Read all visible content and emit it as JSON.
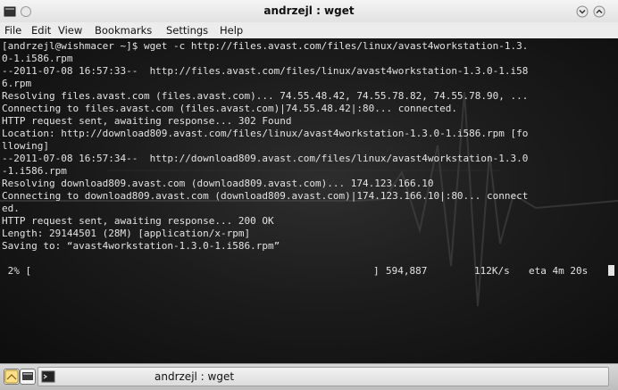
{
  "window": {
    "title": "andrzejl : wget"
  },
  "menubar": {
    "items": [
      "File",
      "Edit",
      "View",
      "Bookmarks",
      "Settings",
      "Help"
    ]
  },
  "terminal": {
    "lines": [
      "[andrzejl@wishmacer ~]$ wget -c http://files.avast.com/files/linux/avast4workstation-1.3.",
      "0-1.i586.rpm",
      "--2011-07-08 16:57:33--  http://files.avast.com/files/linux/avast4workstation-1.3.0-1.i58",
      "6.rpm",
      "Resolving files.avast.com (files.avast.com)... 74.55.48.42, 74.55.78.82, 74.55.78.90, ...",
      "Connecting to files.avast.com (files.avast.com)|74.55.48.42|:80... connected.",
      "HTTP request sent, awaiting response... 302 Found",
      "Location: http://download809.avast.com/files/linux/avast4workstation-1.3.0-1.i586.rpm [fo",
      "llowing]",
      "--2011-07-08 16:57:34--  http://download809.avast.com/files/linux/avast4workstation-1.3.0",
      "-1.i586.rpm",
      "Resolving download809.avast.com (download809.avast.com)... 174.123.166.10",
      "Connecting to download809.avast.com (download809.avast.com)|174.123.166.10|:80... connect",
      "ed.",
      "HTTP request sent, awaiting response... 200 OK",
      "Length: 29144501 (28M) [application/x-rpm]",
      "Saving to: “avast4workstation-1.3.0-1.i586.rpm”"
    ],
    "progress": {
      "percent_text": " 2% [",
      "bracket_close": "]",
      "bytes": "594,887",
      "speed": "112K/s",
      "eta": "eta 4m 20s"
    },
    "progress_fraction": 0.02
  },
  "taskbar": {
    "task_label": "andrzejl : wget"
  },
  "colors": {
    "terminal_text": "#e3e3e3",
    "terminal_bg": "#1c1c1c"
  },
  "icons": [
    "terminal-window-icon",
    "minimize-icon",
    "maximize-icon",
    "launcher-icon",
    "konsole-icon"
  ]
}
